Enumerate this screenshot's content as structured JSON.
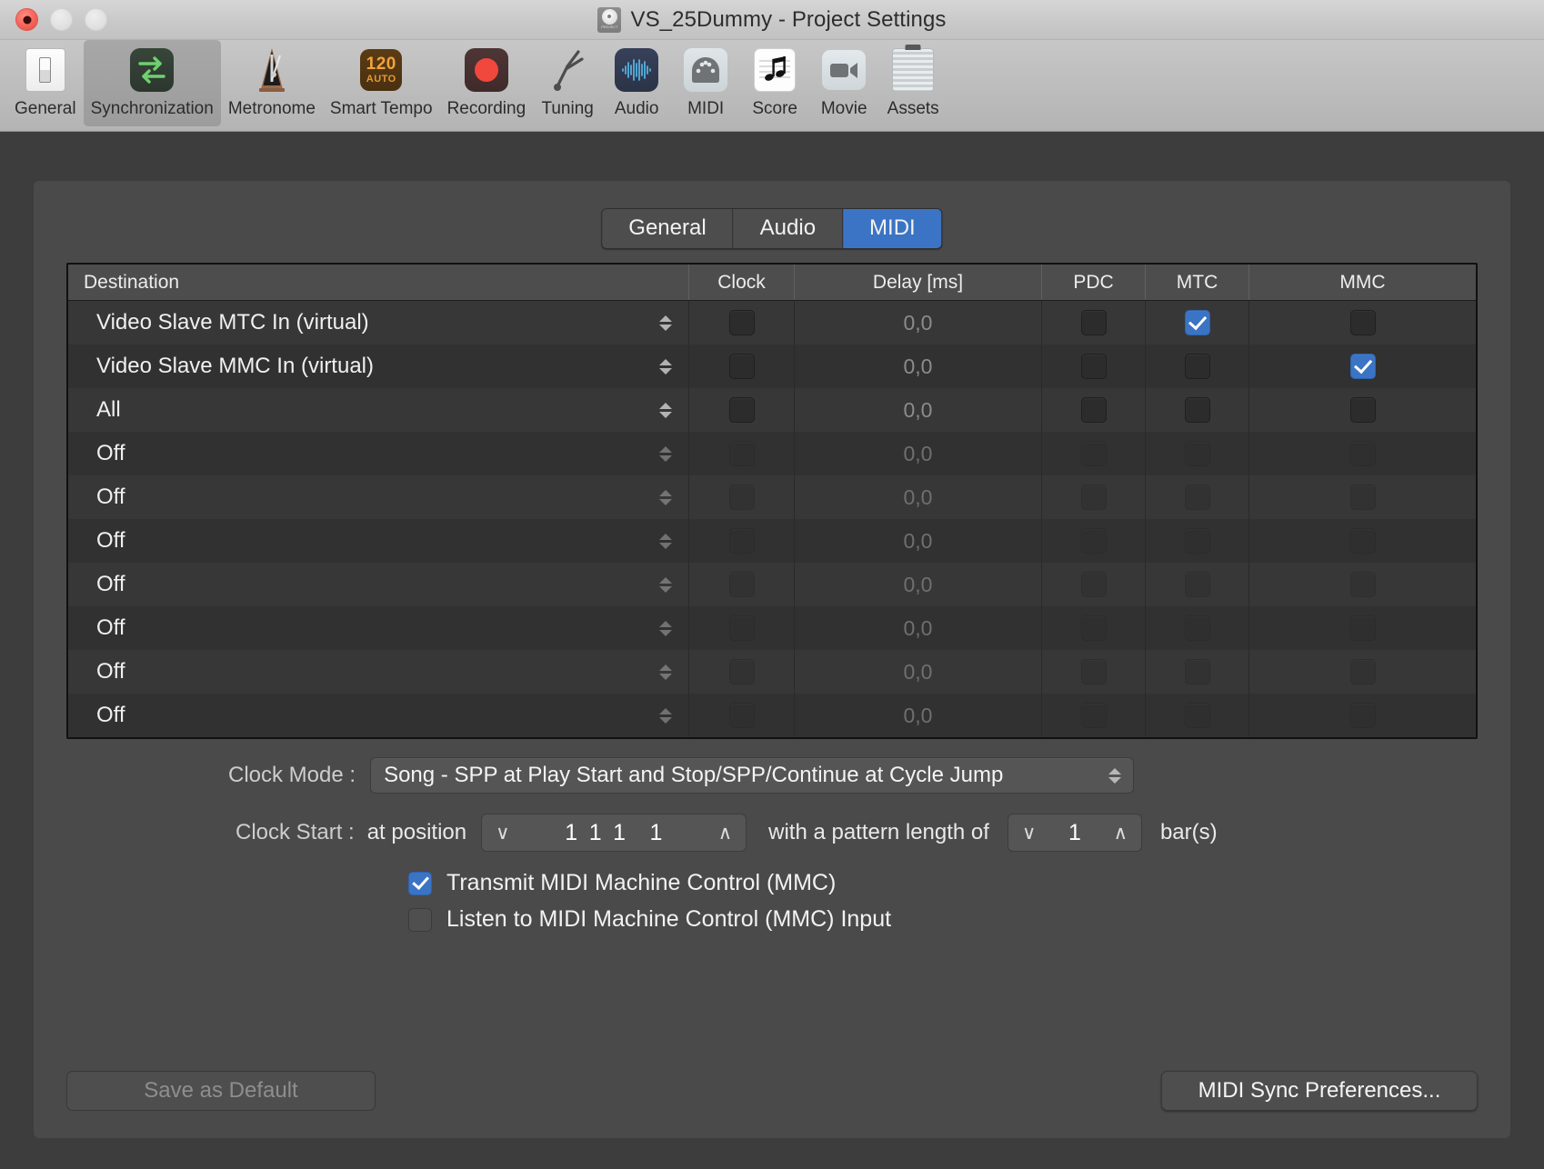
{
  "window": {
    "title": "VS_25Dummy - Project Settings",
    "project_icon": "project-disc-icon",
    "project_icon_label": "PROJECT",
    "traffic_lights": [
      "close",
      "minimize",
      "zoom"
    ]
  },
  "toolbar": {
    "items": [
      {
        "label": "General",
        "icon": "switch-icon",
        "selected": false
      },
      {
        "label": "Synchronization",
        "icon": "sync-arrows-icon",
        "selected": true
      },
      {
        "label": "Metronome",
        "icon": "metronome-icon",
        "selected": false
      },
      {
        "label": "Smart Tempo",
        "icon": "tempo-120-auto-icon",
        "selected": false
      },
      {
        "label": "Recording",
        "icon": "record-dot-icon",
        "selected": false
      },
      {
        "label": "Tuning",
        "icon": "tuning-fork-icon",
        "selected": false
      },
      {
        "label": "Audio",
        "icon": "waveform-icon",
        "selected": false
      },
      {
        "label": "MIDI",
        "icon": "midi-din-icon",
        "selected": false
      },
      {
        "label": "Score",
        "icon": "music-note-icon",
        "selected": false
      },
      {
        "label": "Movie",
        "icon": "video-camera-icon",
        "selected": false
      },
      {
        "label": "Assets",
        "icon": "assets-case-icon",
        "selected": false
      }
    ],
    "tempo_value": "120",
    "tempo_mode": "AUTO"
  },
  "tabs": [
    {
      "label": "General",
      "active": false
    },
    {
      "label": "Audio",
      "active": false
    },
    {
      "label": "MIDI",
      "active": true
    }
  ],
  "table": {
    "columns": [
      "Destination",
      "Clock",
      "Delay [ms]",
      "PDC",
      "MTC",
      "MMC"
    ],
    "rows": [
      {
        "destination": "Video Slave MTC In (virtual)",
        "clock": false,
        "delay": "0,0",
        "pdc": false,
        "mtc": true,
        "mmc": false,
        "enabled": true
      },
      {
        "destination": "Video Slave MMC In (virtual)",
        "clock": false,
        "delay": "0,0",
        "pdc": false,
        "mtc": false,
        "mmc": true,
        "enabled": true
      },
      {
        "destination": "All",
        "clock": false,
        "delay": "0,0",
        "pdc": false,
        "mtc": false,
        "mmc": false,
        "enabled": true
      },
      {
        "destination": "Off",
        "clock": false,
        "delay": "0,0",
        "pdc": false,
        "mtc": false,
        "mmc": false,
        "enabled": false
      },
      {
        "destination": "Off",
        "clock": false,
        "delay": "0,0",
        "pdc": false,
        "mtc": false,
        "mmc": false,
        "enabled": false
      },
      {
        "destination": "Off",
        "clock": false,
        "delay": "0,0",
        "pdc": false,
        "mtc": false,
        "mmc": false,
        "enabled": false
      },
      {
        "destination": "Off",
        "clock": false,
        "delay": "0,0",
        "pdc": false,
        "mtc": false,
        "mmc": false,
        "enabled": false
      },
      {
        "destination": "Off",
        "clock": false,
        "delay": "0,0",
        "pdc": false,
        "mtc": false,
        "mmc": false,
        "enabled": false
      },
      {
        "destination": "Off",
        "clock": false,
        "delay": "0,0",
        "pdc": false,
        "mtc": false,
        "mmc": false,
        "enabled": false
      },
      {
        "destination": "Off",
        "clock": false,
        "delay": "0,0",
        "pdc": false,
        "mtc": false,
        "mmc": false,
        "enabled": false
      }
    ]
  },
  "clock_mode": {
    "label": "Clock Mode :",
    "value": "Song - SPP at Play Start and Stop/SPP/Continue at Cycle Jump"
  },
  "clock_start": {
    "label": "Clock Start :",
    "position_label": "at position",
    "position": {
      "bar": "1",
      "beat": "1",
      "division": "1",
      "tick": "1"
    },
    "pattern_label": "with a pattern length of",
    "pattern_length": "1",
    "unit": "bar(s)",
    "decrement_icon": "chevron-down-icon",
    "increment_icon": "chevron-up-icon"
  },
  "options": [
    {
      "label": "Transmit MIDI Machine Control (MMC)",
      "checked": true
    },
    {
      "label": "Listen to MIDI Machine Control (MMC) Input",
      "checked": false
    }
  ],
  "buttons": {
    "save_as_default": "Save as Default",
    "midi_sync_preferences": "MIDI Sync Preferences..."
  },
  "colors": {
    "accent": "#3b74c4",
    "panel": "#4a4a4a",
    "window_bg": "#3d3d3d",
    "table_row_odd": "#373737",
    "table_row_even": "#313131",
    "titlebar": "#c9c9c9"
  }
}
